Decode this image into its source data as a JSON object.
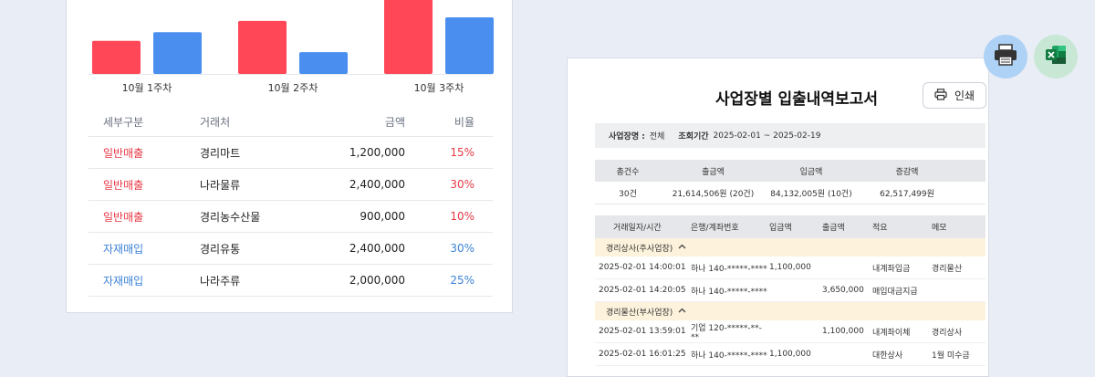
{
  "left": {
    "chart_data": {
      "type": "bar",
      "categories": [
        "10월 1주차",
        "10월 2주차",
        "10월 3주차"
      ],
      "series": [
        {
          "values": [
            38,
            61,
            86
          ],
          "color": "#ff4757"
        },
        {
          "values": [
            48,
            25,
            65
          ],
          "color": "#4a8ff0"
        }
      ],
      "ylim": [
        0,
        86
      ],
      "xlabel": "",
      "ylabel": ""
    },
    "table": {
      "headers": [
        "세부구분",
        "거래처",
        "금액",
        "비율"
      ],
      "rows": [
        {
          "division": "일반매출",
          "vendor": "경리마트",
          "amount": "1,200,000",
          "ratio": "15%",
          "tone": "red"
        },
        {
          "division": "일반매출",
          "vendor": "나라물류",
          "amount": "2,400,000",
          "ratio": "30%",
          "tone": "red"
        },
        {
          "division": "일반매출",
          "vendor": "경리농수산물",
          "amount": "900,000",
          "ratio": "10%",
          "tone": "red"
        },
        {
          "division": "자재매입",
          "vendor": "경리유통",
          "amount": "2,400,000",
          "ratio": "30%",
          "tone": "blue"
        },
        {
          "division": "자재매입",
          "vendor": "나라주류",
          "amount": "2,000,000",
          "ratio": "25%",
          "tone": "blue"
        }
      ]
    }
  },
  "report": {
    "title": "사업장별 입출내역보고서",
    "print_label": "인쇄",
    "filter": {
      "site_label": "사업장명 :",
      "site_value": "전체",
      "period_label": "조회기간",
      "period_value": "2025-02-01 ~ 2025-02-19"
    },
    "summary": {
      "headers": [
        "총건수",
        "출금액",
        "입금액",
        "증감액"
      ],
      "values": [
        "30건",
        "21,614,506원 (20건)",
        "84,132,005원 (10건)",
        "62,517,499원"
      ]
    },
    "detail": {
      "headers": [
        "거래일자/시간",
        "은행/계좌번호",
        "입금액",
        "출금액",
        "적요",
        "메모"
      ],
      "groups": [
        {
          "name": "경리상사(주사업장)",
          "rows": [
            [
              "2025-02-01 14:00:01",
              "하나 140-*****-****",
              "1,100,000",
              "",
              "내계좌입금",
              "경리물산"
            ],
            [
              "2025-02-01 14:20:05",
              "하나 140-*****-****",
              "",
              "3,650,000",
              "매입대금지급",
              ""
            ]
          ]
        },
        {
          "name": "경리물산(부사업장)",
          "rows": [
            [
              "2025-02-01 13:59:01",
              "기업 120-*****-**-**",
              "",
              "1,100,000",
              "내계좌이체",
              "경리상사"
            ],
            [
              "2025-02-01 16:01:25",
              "하나 140-*****-****",
              "1,100,000",
              "",
              "대한상사",
              "1월 미수금"
            ]
          ]
        }
      ]
    }
  },
  "icons": {
    "printer": "printer-icon",
    "excel": "excel-icon",
    "print_button_icon": "printer-outline-icon",
    "chevron": "chevron-up-icon"
  }
}
